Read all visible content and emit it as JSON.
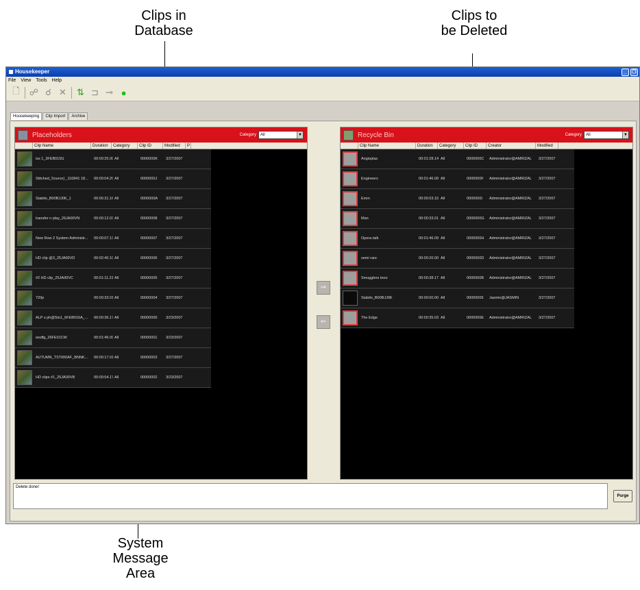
{
  "callouts": {
    "clips_in_database": "Clips in\nDatabase",
    "clips_to_be_deleted": "Clips to\nbe Deleted",
    "system_message_area": "System\nMessage\nArea"
  },
  "window": {
    "title": "Housekeeper"
  },
  "menu": [
    "File",
    "View",
    "Tools",
    "Help"
  ],
  "tabs": [
    {
      "label": "Housekeeping",
      "active": true
    },
    {
      "label": "Clip Import",
      "active": false
    },
    {
      "label": "Archive",
      "active": false
    }
  ],
  "left_panel": {
    "title": "Placeholders",
    "category_label": "Category",
    "category_value": "All",
    "columns": [
      "Clip Name",
      "Duration",
      "Category",
      "Clip ID",
      "Modified",
      "P"
    ],
    "rows": [
      {
        "name": "iss 1_3FEB015G",
        "duration": "00:00:25.00",
        "category": "All",
        "id": "0000000K",
        "modified": "3/27/2007"
      },
      {
        "name": "Stitched_Source] _116841 18...",
        "duration": "00:00:04.20",
        "category": "All",
        "id": "0000000J",
        "modified": "3/27/2007"
      },
      {
        "name": "Stabilo_B00BJJ0K_1",
        "duration": "00:06:31.16",
        "category": "All",
        "id": "0000000A",
        "modified": "3/27/2007"
      },
      {
        "name": "transfer n play_26JA00VN",
        "duration": "00:00:12.03",
        "category": "All",
        "id": "00000008",
        "modified": "3/27/2007"
      },
      {
        "name": "New Row 2 System Administr...",
        "duration": "00:00:07.13",
        "category": "All",
        "id": "00000007",
        "modified": "3/27/2007"
      },
      {
        "name": "HD clip @3_25JA00VD",
        "duration": "00:02:40.10",
        "category": "All",
        "id": "00000006",
        "modified": "3/27/2007"
      },
      {
        "name": "#2 HD clip_25JA00VC",
        "duration": "00:01:11.23",
        "category": "All",
        "id": "00000005",
        "modified": "3/27/2007"
      },
      {
        "name": "720p",
        "duration": "00:00:33.01",
        "category": "All",
        "id": "00000004",
        "modified": "3/27/2007"
      },
      {
        "name": "ALP s ph@Sto1_6FEB016A_...",
        "duration": "00:00:36.17",
        "category": "All",
        "id": "00000000",
        "modified": "3/23/2007"
      },
      {
        "name": "wsdfg_26FE01CW",
        "duration": "00:01:46.09",
        "category": "All",
        "id": "00000001",
        "modified": "3/23/2007"
      },
      {
        "name": "AUTUMN_TST000AF_BNNK...",
        "duration": "00:00:17.01",
        "category": "All",
        "id": "00000003",
        "modified": "3/27/2007"
      },
      {
        "name": "HD clips #1_25JA00VB",
        "duration": "00:00:54.17",
        "category": "All",
        "id": "00000002",
        "modified": "3/23/2007"
      }
    ]
  },
  "right_panel": {
    "title": "Recycle Bin",
    "category_label": "Category",
    "category_value": "All",
    "columns": [
      "Clip Name",
      "Duration",
      "Category",
      "Clip ID",
      "Creator",
      "Modified"
    ],
    "rows": [
      {
        "name": "Angioplas",
        "duration": "00:01:28.14",
        "category": "All",
        "id": "0000000C",
        "creator": "Administrator@AMRIZAL",
        "modified": "3/27/2007"
      },
      {
        "name": "Engineers",
        "duration": "00:01:46.09",
        "category": "All",
        "id": "0000000F",
        "creator": "Administrator@AMRIZAL",
        "modified": "3/27/2007"
      },
      {
        "name": "Emm",
        "duration": "00:00:03.15",
        "category": "All",
        "id": "0000000I",
        "creator": "Administrator@AMRIZAL",
        "modified": "3/27/2007"
      },
      {
        "name": "Man",
        "duration": "00:00:33.01",
        "category": "All",
        "id": "0000000G",
        "creator": "Administrator@AMRIZAL",
        "modified": "3/27/2007"
      },
      {
        "name": "Opera talk",
        "duration": "00:01:46.09",
        "category": "All",
        "id": "0000000H",
        "creator": "Administrator@AMRIZAL",
        "modified": "3/27/2007"
      },
      {
        "name": "semi rare",
        "duration": "00:00:20.00",
        "category": "All",
        "id": "0000000D",
        "creator": "Administrator@AMRIZAL",
        "modified": "3/27/2007"
      },
      {
        "name": "Smugglers tooo",
        "duration": "00:00:38.17",
        "category": "All",
        "id": "0000000B",
        "creator": "Administrator@AMRIZAL",
        "modified": "3/27/2007"
      },
      {
        "name": "Stabilo_B00BJJ0K",
        "duration": "00:00:00.00",
        "category": "All",
        "id": "00000009",
        "creator": "Jasmin@JASMIN",
        "modified": "3/27/2007"
      },
      {
        "name": "The Edge",
        "duration": "00:00:35.03",
        "category": "All",
        "id": "0000000E",
        "creator": "Administrator@AMRIZAL",
        "modified": "3/27/2007"
      }
    ]
  },
  "message": {
    "text": "Delete done!"
  },
  "purge_label": "Purge",
  "colors": {
    "header_red": "#d8111a",
    "panel_black": "#000000",
    "accent_green": "#12c01a"
  }
}
